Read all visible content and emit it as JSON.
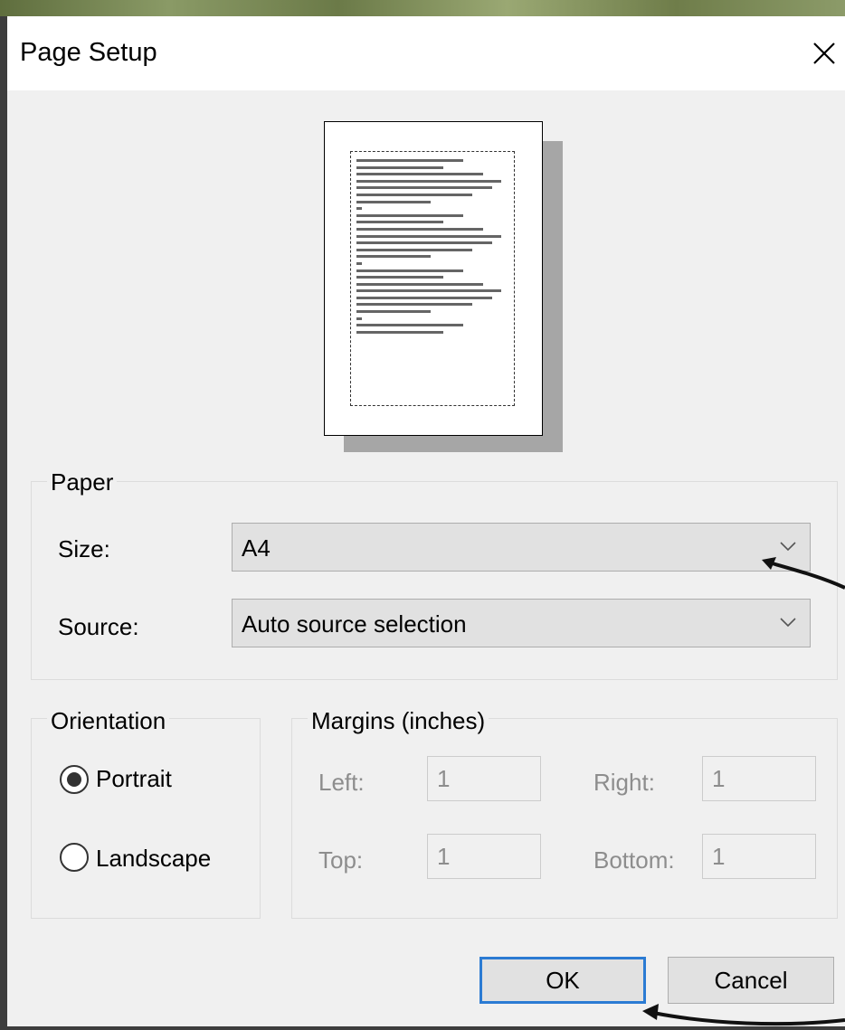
{
  "dialog": {
    "title": "Page Setup"
  },
  "paper": {
    "group_label": "Paper",
    "size_label": "Size:",
    "size_value": "A4",
    "source_label": "Source:",
    "source_value": "Auto source selection"
  },
  "orientation": {
    "group_label": "Orientation",
    "portrait_label": "Portrait",
    "landscape_label": "Landscape",
    "selected": "Portrait"
  },
  "margins": {
    "group_label": "Margins (inches)",
    "left_label": "Left:",
    "left_value": "1",
    "right_label": "Right:",
    "right_value": "1",
    "top_label": "Top:",
    "top_value": "1",
    "bottom_label": "Bottom:",
    "bottom_value": "1"
  },
  "buttons": {
    "ok_label": "OK",
    "cancel_label": "Cancel"
  },
  "icons": {
    "close": "close-icon",
    "dropdown": "chevron-down-icon"
  },
  "colors": {
    "dialog_bg": "#f0f0f0",
    "default_button_border": "#2b7bd3",
    "disabled_text": "#8d8d8d"
  }
}
